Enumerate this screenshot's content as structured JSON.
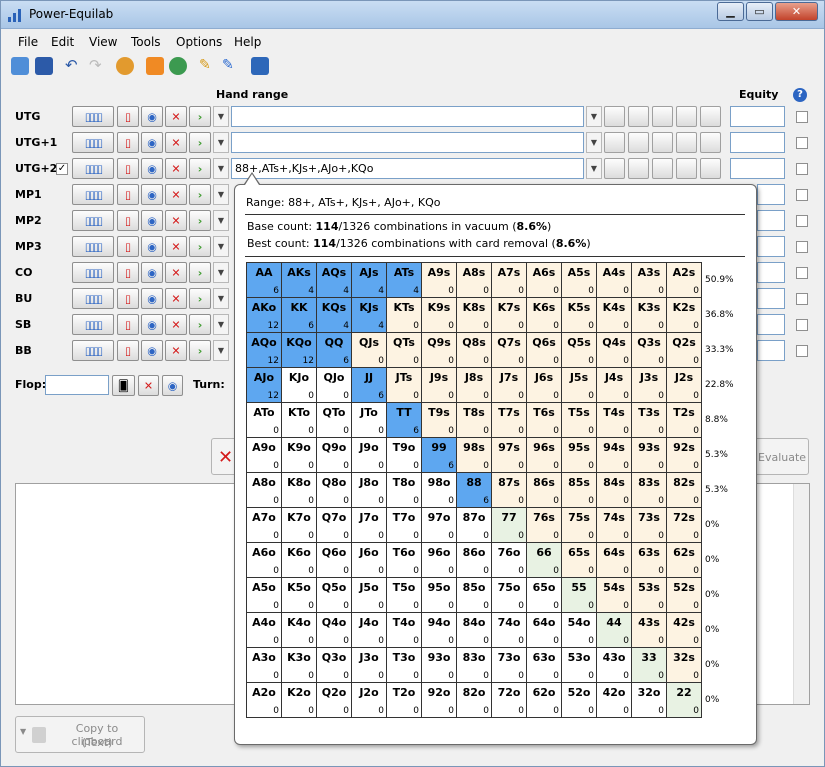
{
  "window": {
    "title": "Power-Equilab"
  },
  "menu": [
    "File",
    "Edit",
    "View",
    "Tools",
    "Options",
    "Help"
  ],
  "headers": {
    "hand_range": "Hand range",
    "equity": "Equity",
    "help_icon": "?"
  },
  "players": [
    {
      "label": "UTG",
      "range": ""
    },
    {
      "label": "UTG+1",
      "range": ""
    },
    {
      "label": "UTG+2",
      "range": "88+,ATs+,KJs+,AJo+,KQo",
      "checked": true
    },
    {
      "label": "MP1",
      "range": ""
    },
    {
      "label": "MP2",
      "range": ""
    },
    {
      "label": "MP3",
      "range": ""
    },
    {
      "label": "CO",
      "range": ""
    },
    {
      "label": "BU",
      "range": ""
    },
    {
      "label": "SB",
      "range": ""
    },
    {
      "label": "BB",
      "range": ""
    }
  ],
  "board": {
    "flop_label": "Flop:",
    "turn_label": "Turn:"
  },
  "evaluate_label": "Evaluate",
  "copy_button": {
    "line1": "Copy to clipboard",
    "line2": "(Text)"
  },
  "tooltip": {
    "range_line": "Range: 88+, ATs+, KJs+, AJo+, KQo",
    "base_prefix": "Base count: ",
    "base_count": "114",
    "base_mid": "/1326 combinations in vacuum (",
    "base_pct": "8.6%",
    "base_suffix": ")",
    "best_prefix": "Best count: ",
    "best_count": "114",
    "best_mid": "/1326 combinations with card removal (",
    "best_pct": "8.6%",
    "best_suffix": ")",
    "grid": [
      [
        [
          "AA",
          6,
          1
        ],
        [
          "AKs",
          4,
          1
        ],
        [
          "AQs",
          4,
          1
        ],
        [
          "AJs",
          4,
          1
        ],
        [
          "ATs",
          4,
          1
        ],
        [
          "A9s",
          0,
          0
        ],
        [
          "A8s",
          0,
          0
        ],
        [
          "A7s",
          0,
          0
        ],
        [
          "A6s",
          0,
          0
        ],
        [
          "A5s",
          0,
          0
        ],
        [
          "A4s",
          0,
          0
        ],
        [
          "A3s",
          0,
          0
        ],
        [
          "A2s",
          0,
          0
        ]
      ],
      [
        [
          "AKo",
          12,
          1
        ],
        [
          "KK",
          6,
          1
        ],
        [
          "KQs",
          4,
          1
        ],
        [
          "KJs",
          4,
          1
        ],
        [
          "KTs",
          0,
          0
        ],
        [
          "K9s",
          0,
          0
        ],
        [
          "K8s",
          0,
          0
        ],
        [
          "K7s",
          0,
          0
        ],
        [
          "K6s",
          0,
          0
        ],
        [
          "K5s",
          0,
          0
        ],
        [
          "K4s",
          0,
          0
        ],
        [
          "K3s",
          0,
          0
        ],
        [
          "K2s",
          0,
          0
        ]
      ],
      [
        [
          "AQo",
          12,
          1
        ],
        [
          "KQo",
          12,
          1
        ],
        [
          "QQ",
          6,
          1
        ],
        [
          "QJs",
          0,
          0
        ],
        [
          "QTs",
          0,
          0
        ],
        [
          "Q9s",
          0,
          0
        ],
        [
          "Q8s",
          0,
          0
        ],
        [
          "Q7s",
          0,
          0
        ],
        [
          "Q6s",
          0,
          0
        ],
        [
          "Q5s",
          0,
          0
        ],
        [
          "Q4s",
          0,
          0
        ],
        [
          "Q3s",
          0,
          0
        ],
        [
          "Q2s",
          0,
          0
        ]
      ],
      [
        [
          "AJo",
          12,
          1
        ],
        [
          "KJo",
          0,
          0
        ],
        [
          "QJo",
          0,
          0
        ],
        [
          "JJ",
          6,
          1
        ],
        [
          "JTs",
          0,
          0
        ],
        [
          "J9s",
          0,
          0
        ],
        [
          "J8s",
          0,
          0
        ],
        [
          "J7s",
          0,
          0
        ],
        [
          "J6s",
          0,
          0
        ],
        [
          "J5s",
          0,
          0
        ],
        [
          "J4s",
          0,
          0
        ],
        [
          "J3s",
          0,
          0
        ],
        [
          "J2s",
          0,
          0
        ]
      ],
      [
        [
          "ATo",
          0,
          0
        ],
        [
          "KTo",
          0,
          0
        ],
        [
          "QTo",
          0,
          0
        ],
        [
          "JTo",
          0,
          0
        ],
        [
          "TT",
          6,
          1
        ],
        [
          "T9s",
          0,
          0
        ],
        [
          "T8s",
          0,
          0
        ],
        [
          "T7s",
          0,
          0
        ],
        [
          "T6s",
          0,
          0
        ],
        [
          "T5s",
          0,
          0
        ],
        [
          "T4s",
          0,
          0
        ],
        [
          "T3s",
          0,
          0
        ],
        [
          "T2s",
          0,
          0
        ]
      ],
      [
        [
          "A9o",
          0,
          0
        ],
        [
          "K9o",
          0,
          0
        ],
        [
          "Q9o",
          0,
          0
        ],
        [
          "J9o",
          0,
          0
        ],
        [
          "T9o",
          0,
          0
        ],
        [
          "99",
          6,
          1
        ],
        [
          "98s",
          0,
          0
        ],
        [
          "97s",
          0,
          0
        ],
        [
          "96s",
          0,
          0
        ],
        [
          "95s",
          0,
          0
        ],
        [
          "94s",
          0,
          0
        ],
        [
          "93s",
          0,
          0
        ],
        [
          "92s",
          0,
          0
        ]
      ],
      [
        [
          "A8o",
          0,
          0
        ],
        [
          "K8o",
          0,
          0
        ],
        [
          "Q8o",
          0,
          0
        ],
        [
          "J8o",
          0,
          0
        ],
        [
          "T8o",
          0,
          0
        ],
        [
          "98o",
          0,
          0
        ],
        [
          "88",
          6,
          1
        ],
        [
          "87s",
          0,
          0
        ],
        [
          "86s",
          0,
          0
        ],
        [
          "85s",
          0,
          0
        ],
        [
          "84s",
          0,
          0
        ],
        [
          "83s",
          0,
          0
        ],
        [
          "82s",
          0,
          0
        ]
      ],
      [
        [
          "A7o",
          0,
          0
        ],
        [
          "K7o",
          0,
          0
        ],
        [
          "Q7o",
          0,
          0
        ],
        [
          "J7o",
          0,
          0
        ],
        [
          "T7o",
          0,
          0
        ],
        [
          "97o",
          0,
          0
        ],
        [
          "87o",
          0,
          0
        ],
        [
          "77",
          0,
          0
        ],
        [
          "76s",
          0,
          0
        ],
        [
          "75s",
          0,
          0
        ],
        [
          "74s",
          0,
          0
        ],
        [
          "73s",
          0,
          0
        ],
        [
          "72s",
          0,
          0
        ]
      ],
      [
        [
          "A6o",
          0,
          0
        ],
        [
          "K6o",
          0,
          0
        ],
        [
          "Q6o",
          0,
          0
        ],
        [
          "J6o",
          0,
          0
        ],
        [
          "T6o",
          0,
          0
        ],
        [
          "96o",
          0,
          0
        ],
        [
          "86o",
          0,
          0
        ],
        [
          "76o",
          0,
          0
        ],
        [
          "66",
          0,
          0
        ],
        [
          "65s",
          0,
          0
        ],
        [
          "64s",
          0,
          0
        ],
        [
          "63s",
          0,
          0
        ],
        [
          "62s",
          0,
          0
        ]
      ],
      [
        [
          "A5o",
          0,
          0
        ],
        [
          "K5o",
          0,
          0
        ],
        [
          "Q5o",
          0,
          0
        ],
        [
          "J5o",
          0,
          0
        ],
        [
          "T5o",
          0,
          0
        ],
        [
          "95o",
          0,
          0
        ],
        [
          "85o",
          0,
          0
        ],
        [
          "75o",
          0,
          0
        ],
        [
          "65o",
          0,
          0
        ],
        [
          "55",
          0,
          0
        ],
        [
          "54s",
          0,
          0
        ],
        [
          "53s",
          0,
          0
        ],
        [
          "52s",
          0,
          0
        ]
      ],
      [
        [
          "A4o",
          0,
          0
        ],
        [
          "K4o",
          0,
          0
        ],
        [
          "Q4o",
          0,
          0
        ],
        [
          "J4o",
          0,
          0
        ],
        [
          "T4o",
          0,
          0
        ],
        [
          "94o",
          0,
          0
        ],
        [
          "84o",
          0,
          0
        ],
        [
          "74o",
          0,
          0
        ],
        [
          "64o",
          0,
          0
        ],
        [
          "54o",
          0,
          0
        ],
        [
          "44",
          0,
          0
        ],
        [
          "43s",
          0,
          0
        ],
        [
          "42s",
          0,
          0
        ]
      ],
      [
        [
          "A3o",
          0,
          0
        ],
        [
          "K3o",
          0,
          0
        ],
        [
          "Q3o",
          0,
          0
        ],
        [
          "J3o",
          0,
          0
        ],
        [
          "T3o",
          0,
          0
        ],
        [
          "93o",
          0,
          0
        ],
        [
          "83o",
          0,
          0
        ],
        [
          "73o",
          0,
          0
        ],
        [
          "63o",
          0,
          0
        ],
        [
          "53o",
          0,
          0
        ],
        [
          "43o",
          0,
          0
        ],
        [
          "33",
          0,
          0
        ],
        [
          "32s",
          0,
          0
        ]
      ],
      [
        [
          "A2o",
          0,
          0
        ],
        [
          "K2o",
          0,
          0
        ],
        [
          "Q2o",
          0,
          0
        ],
        [
          "J2o",
          0,
          0
        ],
        [
          "T2o",
          0,
          0
        ],
        [
          "92o",
          0,
          0
        ],
        [
          "82o",
          0,
          0
        ],
        [
          "72o",
          0,
          0
        ],
        [
          "62o",
          0,
          0
        ],
        [
          "52o",
          0,
          0
        ],
        [
          "42o",
          0,
          0
        ],
        [
          "32o",
          0,
          0
        ],
        [
          "22",
          0,
          0
        ]
      ]
    ],
    "row_pcts": [
      "50.9%",
      "36.8%",
      "33.3%",
      "22.8%",
      "8.8%",
      "5.3%",
      "5.3%",
      "0%",
      "0%",
      "0%",
      "0%",
      "0%",
      "0%"
    ]
  },
  "colors": {
    "selected": "#5ea7f0",
    "suited": "#fdf3e2",
    "pair": "#e8f2e3",
    "offsuit": "#ffffff"
  },
  "icons": [
    "app-icon",
    "minimize-icon",
    "maximize-icon",
    "close-icon",
    "open-icon",
    "save-icon",
    "undo-icon",
    "redo-icon",
    "settings-icon",
    "fire-icon",
    "refresh-icon",
    "pencil-icon",
    "edit-icon",
    "book-icon",
    "cards-icon",
    "card-icon",
    "chips-icon",
    "clear-icon",
    "arrow-right-icon",
    "help-icon"
  ]
}
